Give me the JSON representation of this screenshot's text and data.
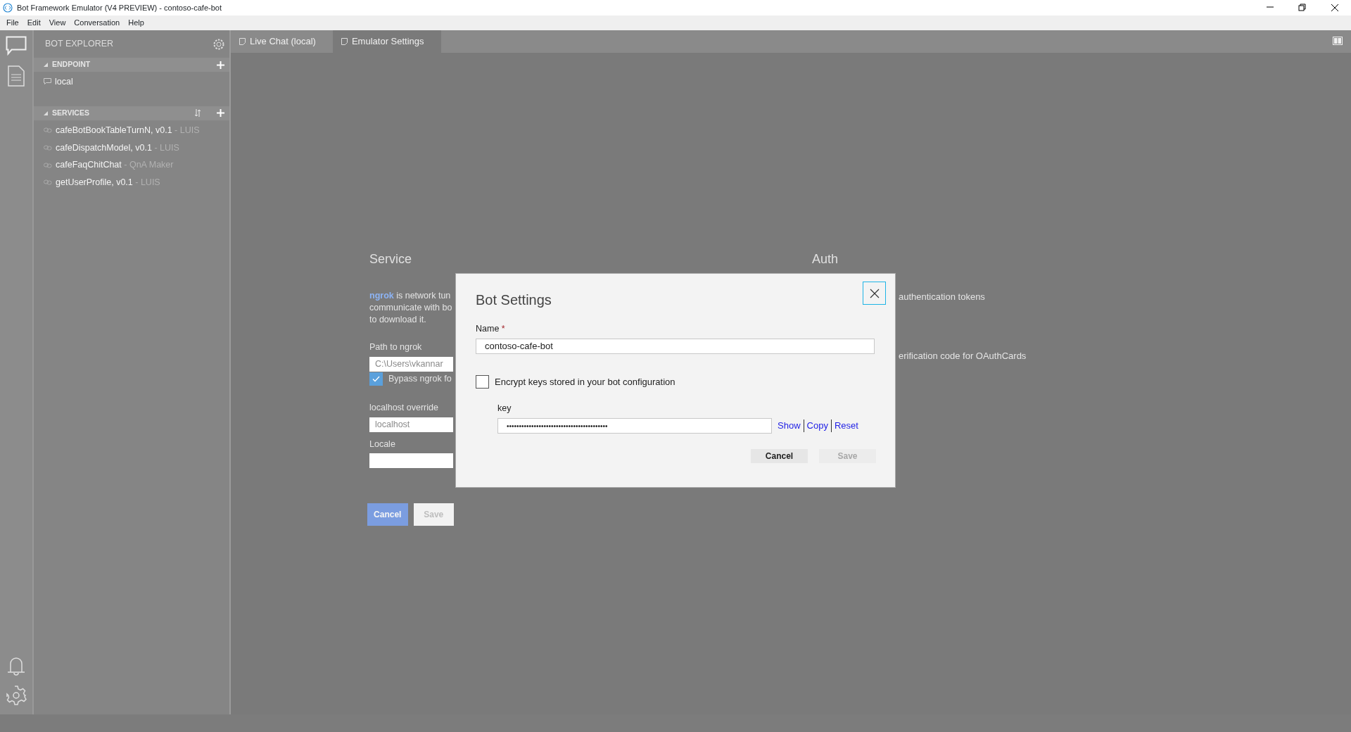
{
  "window": {
    "title": "Bot Framework Emulator (V4 PREVIEW) - contoso-cafe-bot"
  },
  "menu": [
    "File",
    "Edit",
    "View",
    "Conversation",
    "Help"
  ],
  "explorer": {
    "title": "BOT EXPLORER",
    "sections": [
      {
        "title": "ENDPOINT",
        "expanded": true,
        "kind": "endpoint",
        "items": [
          {
            "name": "local"
          }
        ]
      },
      {
        "title": "SERVICES",
        "expanded": true,
        "kind": "services",
        "items": [
          {
            "name": "cafeBotBookTableTurnN, v0.1",
            "suffix": "- LUIS"
          },
          {
            "name": "cafeDispatchModel, v0.1",
            "suffix": "- LUIS"
          },
          {
            "name": "cafeFaqChitChat",
            "suffix": "- QnA Maker"
          },
          {
            "name": "getUserProfile, v0.1",
            "suffix": "- LUIS"
          }
        ]
      }
    ]
  },
  "tabs": [
    {
      "label": "Live Chat (local)",
      "selected": false
    },
    {
      "label": "Emulator Settings",
      "selected": true
    }
  ],
  "settings": {
    "service": {
      "heading": "Service",
      "link": "ngrok",
      "lines": [
        "is network tun",
        "communicate with bo",
        "to download it."
      ],
      "path_label": "Path to ngrok",
      "path_value": "C:\\Users\\vkannar",
      "bypass": {
        "label": "Bypass ngrok fo",
        "checked": true
      },
      "localhost_label": "localhost override",
      "localhost_value": "localhost",
      "locale_label": "Locale"
    },
    "auth": {
      "heading": "Auth",
      "lines": [
        "authentication tokens",
        "erification code for OAuthCards"
      ]
    },
    "buttons": [
      {
        "label": "Cancel",
        "disabled": false
      },
      {
        "label": "Save",
        "disabled": true
      }
    ]
  },
  "dialog": {
    "title": "Bot Settings",
    "name_label": "Name",
    "required_mark": "*",
    "name_value": "contoso-cafe-bot",
    "encrypt": {
      "label": "Encrypt keys stored in your bot configuration",
      "checked": false
    },
    "key_label": "key",
    "key_value": "•••••••••••••••••••••••••••••••••••••••••",
    "key_actions": [
      "Show",
      "Copy",
      "Reset"
    ],
    "buttons": [
      {
        "label": "Cancel",
        "disabled": false
      },
      {
        "label": "Save",
        "disabled": true
      }
    ]
  }
}
